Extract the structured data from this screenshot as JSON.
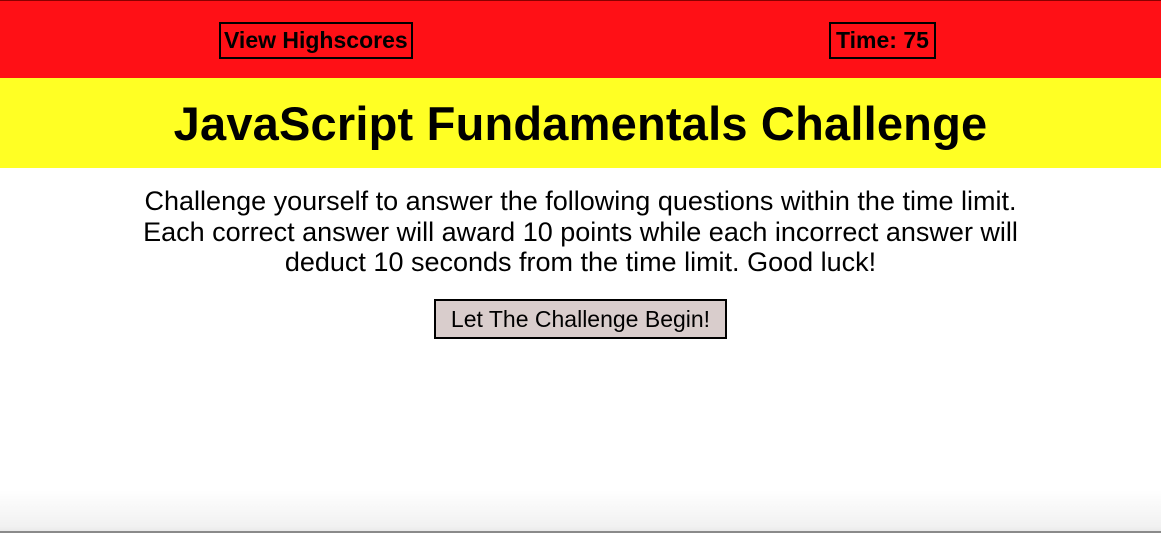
{
  "header": {
    "highscores_label": "View Highscores",
    "timer_label": "Time: 75"
  },
  "title": "JavaScript Fundamentals Challenge",
  "intro_text": "Challenge yourself to answer the following questions within the time limit. Each correct answer will award 10 points while each incorrect answer will deduct 10 seconds from the time limit. Good luck!",
  "start_button_label": "Let The Challenge Begin!",
  "colors": {
    "header_bg": "#ff1016",
    "title_bg": "#ffff24",
    "button_bg": "#d9cdcc"
  }
}
